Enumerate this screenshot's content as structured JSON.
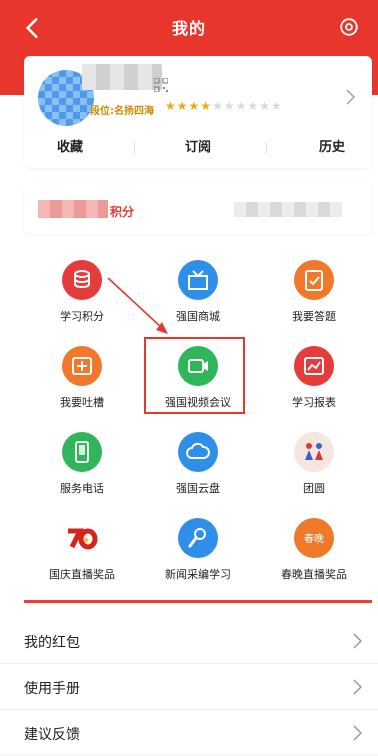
{
  "nav": {
    "title": "我的"
  },
  "profile": {
    "rank": "段位:名扬四海",
    "stars_filled": 4,
    "stars_total": 10,
    "tabs": [
      "收藏",
      "订阅",
      "历史"
    ]
  },
  "points": {
    "label": "积分"
  },
  "features": [
    {
      "label": "学习积分",
      "icon": "coins-icon",
      "color": "#e43b3b"
    },
    {
      "label": "强国商城",
      "icon": "shop-icon",
      "color": "#2e8ee8"
    },
    {
      "label": "我要答题",
      "icon": "quiz-icon",
      "color": "#f0782a"
    },
    {
      "label": "我要吐槽",
      "icon": "feedback-box-icon",
      "color": "#f0782a"
    },
    {
      "label": "强国视频会议",
      "icon": "video-call-icon",
      "color": "#2fb65a"
    },
    {
      "label": "学习报表",
      "icon": "report-icon",
      "color": "#e43b3b"
    },
    {
      "label": "服务电话",
      "icon": "phone-icon",
      "color": "#2fb65a"
    },
    {
      "label": "强国云盘",
      "icon": "cloud-icon",
      "color": "#2e8ee8"
    },
    {
      "label": "团圆",
      "icon": "reunion-icon",
      "color": "#f6e6e0"
    },
    {
      "label": "国庆直播奖品",
      "icon": "national-day-70-icon",
      "color": "#ffffff"
    },
    {
      "label": "新闻采编学习",
      "icon": "microphone-icon",
      "color": "#2e8ee8"
    },
    {
      "label": "春晚直播奖品",
      "icon": "spring-gala-icon",
      "color": "#f0782a",
      "badge": "春晚"
    }
  ],
  "menu": [
    {
      "label": "我的红包"
    },
    {
      "label": "使用手册"
    },
    {
      "label": "建议反馈"
    }
  ]
}
